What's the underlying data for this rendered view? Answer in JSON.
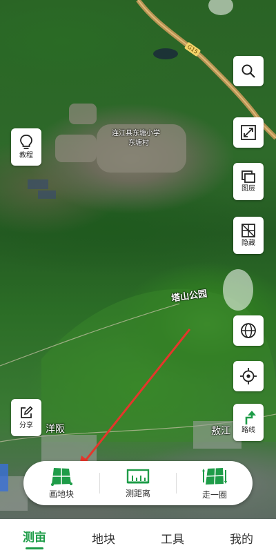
{
  "map": {
    "labels": {
      "school": "连江县东塘小学",
      "village": "东塘村",
      "park": "塔山公园",
      "west": "洋阪",
      "east": "敖江"
    },
    "road_shield": "G15"
  },
  "left_buttons": {
    "tutorial": "教程",
    "share": "分享"
  },
  "right_buttons": {
    "layers": "图层",
    "hide": "隐藏",
    "route": "路线"
  },
  "actions": [
    {
      "label": "画地块",
      "icon": "draw-plot-icon"
    },
    {
      "label": "测距离",
      "icon": "measure-distance-icon"
    },
    {
      "label": "走一圈",
      "icon": "walk-around-icon"
    }
  ],
  "tabs": [
    {
      "label": "测亩",
      "active": true
    },
    {
      "label": "地块",
      "active": false
    },
    {
      "label": "工具",
      "active": false
    },
    {
      "label": "我的",
      "active": false
    }
  ],
  "colors": {
    "accent": "#1e9c48",
    "arrow": "#e5362b"
  }
}
